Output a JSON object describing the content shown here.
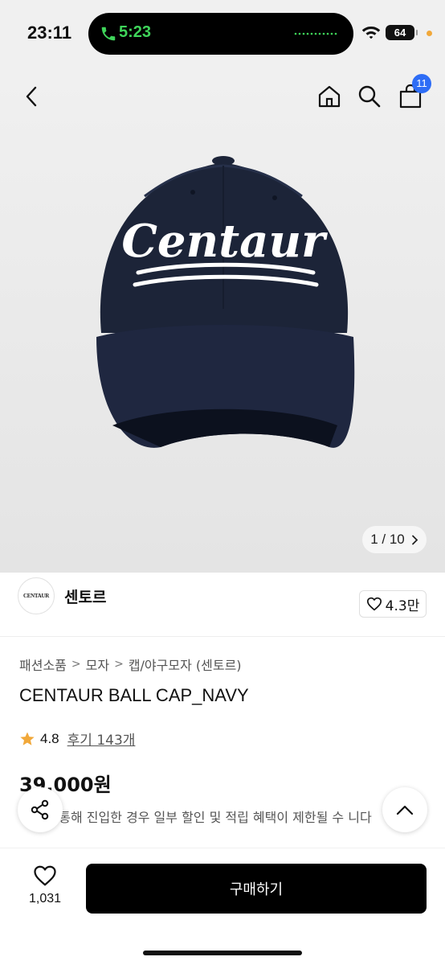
{
  "status_bar": {
    "time": "23:11",
    "call_time": "5:23",
    "battery": "64"
  },
  "gallery": {
    "brand_text": "Centaur",
    "counter": "1 / 10"
  },
  "header": {
    "cart_count": "11"
  },
  "brand": {
    "logo_text": "CENTAUR",
    "name": "센토르",
    "likes": "4.3만"
  },
  "breadcrumb": [
    "패션소품",
    "모자",
    "캡/야구모자 (센토르)"
  ],
  "product": {
    "title": "CENTAUR BALL CAP_NAVY",
    "rating": "4.8",
    "reviews": "후기 143개",
    "price": "39,000원",
    "notice": "링크를 통해 진입한 경우 일부 할인 및 적립 혜택이 제한될 수 니다"
  },
  "bottom_bar": {
    "wish_count": "1,031",
    "buy_label": "구매하기"
  },
  "colors": {
    "cap_navy": "#1c2438",
    "badge_blue": "#2e6df6",
    "star": "#f1a83a",
    "call_green": "#3fd45a"
  }
}
